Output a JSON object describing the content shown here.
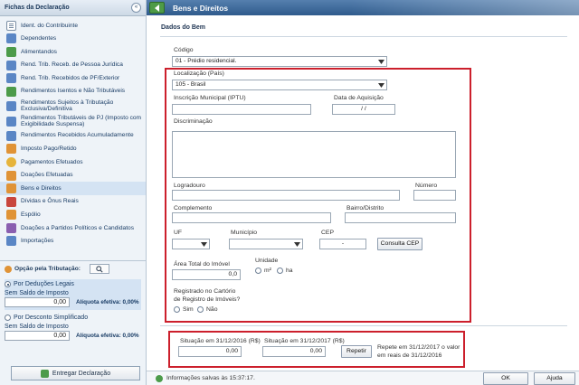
{
  "sidebar": {
    "title": "Fichas da Declaração",
    "collapse_glyph": "«",
    "items": [
      {
        "label": "Ident. do Contribuinte",
        "icon": "doc"
      },
      {
        "label": "Dependentes",
        "icon": "blue"
      },
      {
        "label": "Alimentandos",
        "icon": "green"
      },
      {
        "label": "Rend. Trib. Receb. de Pessoa Jurídica",
        "icon": "blue"
      },
      {
        "label": "Rend. Trib. Recebidos de PF/Exterior",
        "icon": "blue"
      },
      {
        "label": "Rendimentos Isentos e Não Tributáveis",
        "icon": "green"
      },
      {
        "label": "Rendimentos Sujeitos à Tributação Exclusiva/Definitiva",
        "icon": "blue"
      },
      {
        "label": "Rendimentos Tributáveis de PJ (Imposto com Exigibilidade Suspensa)",
        "icon": "blue"
      },
      {
        "label": "Rendimentos Recebidos Acumuladamente",
        "icon": "blue"
      },
      {
        "label": "Imposto Pago/Retido",
        "icon": "orange"
      },
      {
        "label": "Pagamentos Efetuados",
        "icon": "coin"
      },
      {
        "label": "Doações Efetuadas",
        "icon": "orange"
      },
      {
        "label": "Bens e Direitos",
        "icon": "orange"
      },
      {
        "label": "Dívidas e Ônus Reais",
        "icon": "red"
      },
      {
        "label": "Espólio",
        "icon": "orange"
      },
      {
        "label": "Doações a Partidos Políticos e Candidatos",
        "icon": "purple"
      },
      {
        "label": "Importações",
        "icon": "blue"
      }
    ],
    "active_index": 12
  },
  "tributacao": {
    "title": "Opção pela Tributação:",
    "legais": {
      "label": "Por Deduções Legais",
      "saldo_label": "Sem Saldo de Imposto",
      "value": "0,00",
      "aliquota": "Alíquota efetiva: 0,00%"
    },
    "simplificado": {
      "label": "Por Desconto Simplificado",
      "saldo_label": "Sem Saldo de Imposto",
      "value": "0,00",
      "aliquota": "Alíquota efetiva: 0,00%"
    },
    "entregar_label": "Entregar Declaração"
  },
  "header": {
    "title": "Bens e Direitos"
  },
  "form": {
    "section_title": "Dados do Bem",
    "codigo_label": "Código",
    "codigo_value": "01 - Prédio residencial.",
    "localizacao_label": "Localização (País)",
    "localizacao_value": "105 - Brasil",
    "iptu_label": "Inscrição Municipal (IPTU)",
    "iptu_value": "",
    "data_aquisicao_label": "Data de Aquisição",
    "data_aquisicao_value": "/ /",
    "discriminacao_label": "Discriminação",
    "logradouro_label": "Logradouro",
    "numero_label": "Número",
    "complemento_label": "Complemento",
    "bairro_label": "Bairro/Distrito",
    "uf_label": "UF",
    "municipio_label": "Município",
    "cep_label": "CEP",
    "cep_value": "-",
    "consulta_cep_label": "Consulta CEP",
    "area_label": "Área Total do Imóvel",
    "area_value": "0,0",
    "unidade_label": "Unidade",
    "unidade_m2": "m²",
    "unidade_ha": "ha",
    "registrado_label_1": "Registrado no Cartório",
    "registrado_label_2": "de Registro de Imóveis?",
    "sim_label": "Sim",
    "nao_label": "Não",
    "situacao_2016_label": "Situação em 31/12/2016 (R$)",
    "situacao_2016_value": "0,00",
    "situacao_2017_label": "Situação em 31/12/2017 (R$)",
    "situacao_2017_value": "0,00",
    "repetir_label": "Repetir",
    "repetir_hint_1": "Repete em 31/12/2017 o valor",
    "repetir_hint_2": "em reais de 31/12/2016"
  },
  "footer": {
    "status": "Informações salvas às 15:37:17.",
    "ok_label": "OK",
    "ajuda_label": "Ajuda"
  },
  "colors": {
    "highlight_border": "#cc1f2c",
    "header_blue": "#2f5b8c",
    "sidebar_bg": "#eef3f8"
  }
}
